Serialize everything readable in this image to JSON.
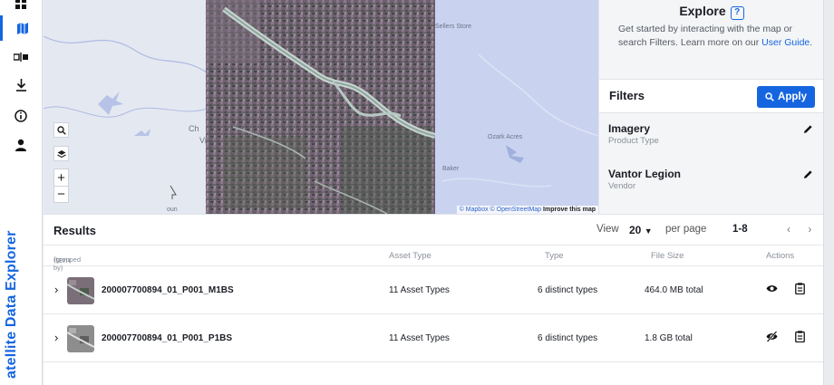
{
  "app": {
    "title": "Satellite Data Explorer",
    "title_visible": "atellite Data Explorer"
  },
  "colors": {
    "accent": "#1565e0",
    "panel_bg": "#f4f5f7",
    "water": "#c9d3f0"
  },
  "rail": {
    "items": [
      {
        "name": "grid-icon",
        "active": false
      },
      {
        "name": "map-icon",
        "active": true
      },
      {
        "name": "compare-icon",
        "active": false
      },
      {
        "name": "download-icon",
        "active": false
      },
      {
        "name": "info-icon",
        "active": false
      },
      {
        "name": "user-icon",
        "active": false
      }
    ]
  },
  "map": {
    "labels": {
      "place1": "Sellers Store",
      "place2": "Ozark Acres",
      "place3": "Baker",
      "place4": "Ch",
      "place5": "Vi",
      "place6": "oun"
    },
    "attribution": {
      "mapbox": "© Mapbox",
      "osm": "© OpenStreetMap",
      "improve": "Improve this map"
    }
  },
  "explore": {
    "title": "Explore",
    "help_icon": "question-circle-icon",
    "description": "Get started by interacting with the map or search Filters. Learn more on our",
    "link": "User Guide",
    "period": "."
  },
  "filters": {
    "heading": "Filters",
    "apply_label": "Apply",
    "items": [
      {
        "name": "Imagery",
        "sub": "Product Type"
      },
      {
        "name": "Vantor Legion",
        "sub": "Vendor"
      }
    ]
  },
  "results": {
    "title": "Results",
    "view_label": "View",
    "per_page": "20",
    "per_page_label": "per page",
    "range": "1-8",
    "columns": {
      "item": "Item",
      "item_sub": "(grouped by)",
      "asset_type": "Asset Type",
      "type": "Type",
      "file_size": "File Size",
      "actions": "Actions"
    },
    "rows": [
      {
        "name": "200007700894_01_P001_M1BS",
        "asset_type": "11 Asset Types",
        "type": "6 distinct types",
        "file_size": "464.0 MB total",
        "visible": true
      },
      {
        "name": "200007700894_01_P001_P1BS",
        "asset_type": "11 Asset Types",
        "type": "6 distinct types",
        "file_size": "1.8 GB total",
        "visible": false
      }
    ]
  }
}
